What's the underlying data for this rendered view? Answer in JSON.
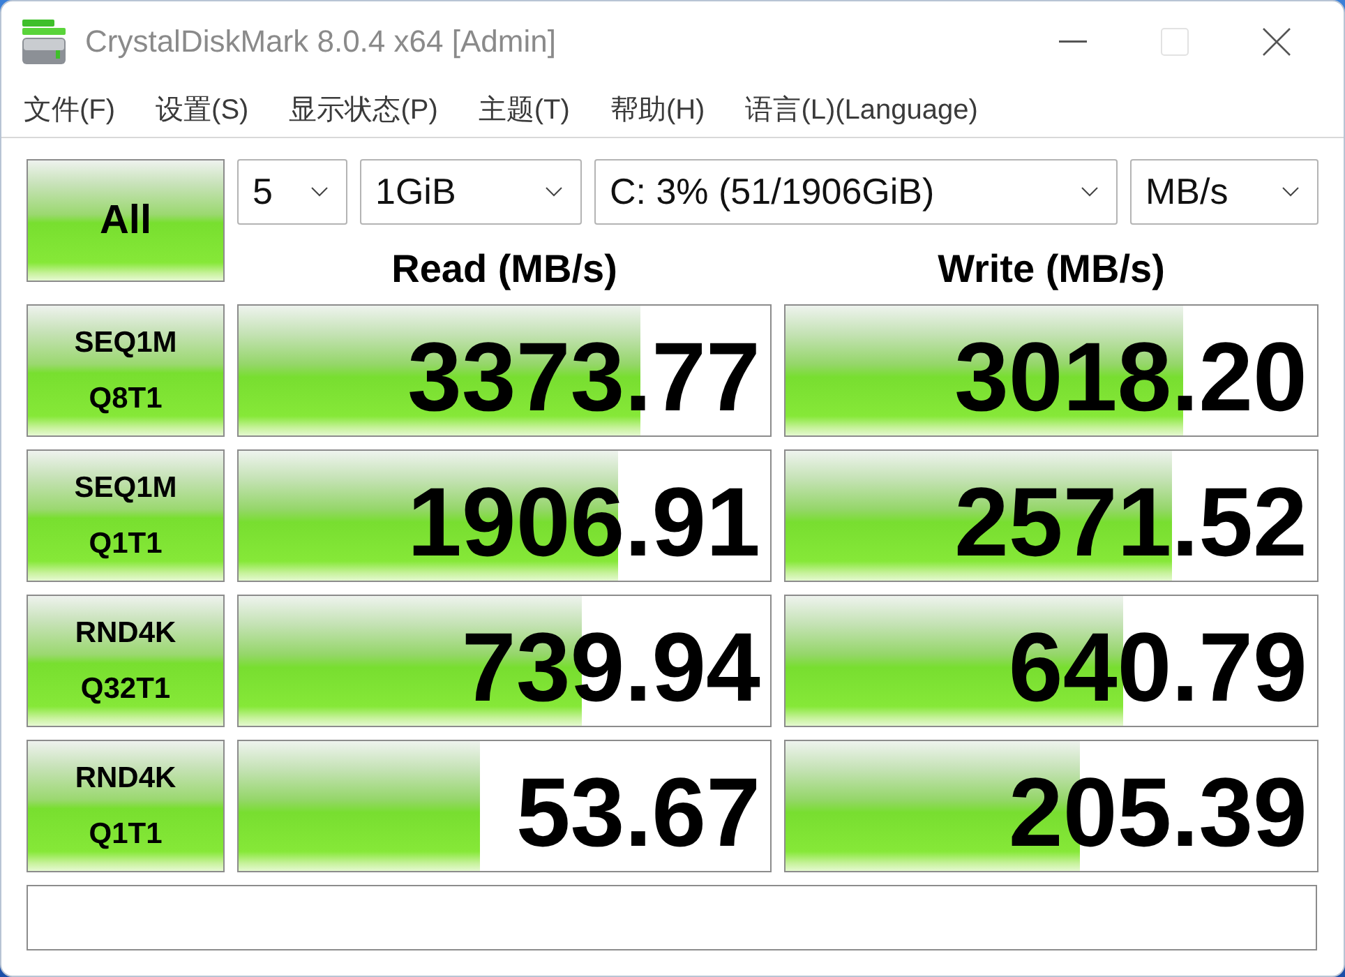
{
  "window": {
    "title": "CrystalDiskMark 8.0.4 x64 [Admin]",
    "maximize_disabled": true
  },
  "menu": [
    "文件(F)",
    "设置(S)",
    "显示状态(P)",
    "主题(T)",
    "帮助(H)",
    "语言(L)(Language)"
  ],
  "toolbar": {
    "all_button": "All",
    "count": "5",
    "size": "1GiB",
    "drive": "C: 3% (51/1906GiB)",
    "unit": "MB/s"
  },
  "headers": {
    "read": "Read (MB/s)",
    "write": "Write (MB/s)"
  },
  "rows": [
    {
      "test": "SEQ1M",
      "params": "Q8T1",
      "read": {
        "value": "3373.77",
        "level": 0.755
      },
      "write": {
        "value": "3018.20",
        "level": 0.747
      }
    },
    {
      "test": "SEQ1M",
      "params": "Q1T1",
      "read": {
        "value": "1906.91",
        "level": 0.713
      },
      "write": {
        "value": "2571.52",
        "level": 0.728
      }
    },
    {
      "test": "RND4K",
      "params": "Q32T1",
      "read": {
        "value": "739.94",
        "level": 0.645
      },
      "write": {
        "value": "640.79",
        "level": 0.634
      }
    },
    {
      "test": "RND4K",
      "params": "Q1T1",
      "read": {
        "value": "53.67",
        "level": 0.454
      },
      "write": {
        "value": "205.39",
        "level": 0.553
      }
    }
  ]
}
